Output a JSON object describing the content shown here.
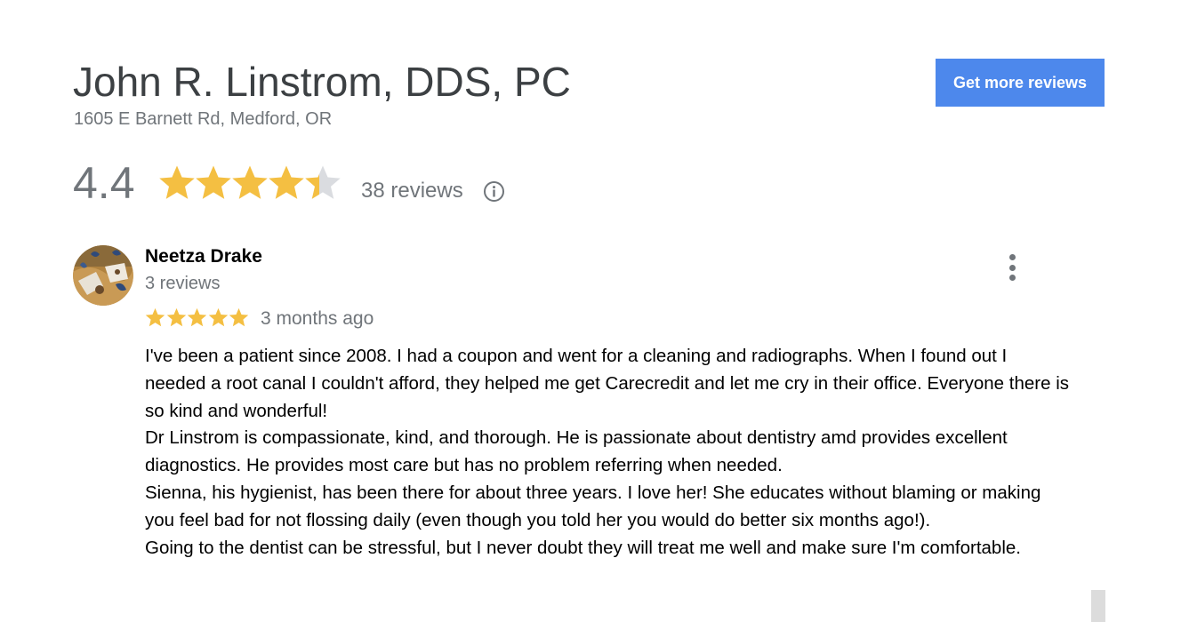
{
  "business": {
    "name": "John R. Linstrom, DDS, PC",
    "address": "1605 E Barnett Rd, Medford, OR",
    "cta_label": "Get more reviews",
    "accent_color": "#4d88ec"
  },
  "rating": {
    "value": "4.4",
    "stars_filled": 4.4,
    "stars_total": 5,
    "review_count": "38 reviews",
    "info_icon": "info-icon",
    "star_color": "#f4bf42"
  },
  "review": {
    "author": "Neetza Drake",
    "author_reviews": "3 reviews",
    "rating": 5,
    "time": "3 months ago",
    "menu_icon": "more-vertical-icon",
    "paragraphs": [
      "I've been a patient since 2008. I had a coupon and went for a cleaning and radiographs. When I found out I needed a root canal I couldn't afford, they helped me get Carecredit and let me cry in their office. Everyone there is so kind and wonderful!",
      "Dr Linstrom is compassionate, kind, and thorough. He is passionate about dentistry amd provides excellent diagnostics. He provides most care but has no problem referring when needed.",
      "Sienna, his hygienist, has been there for about three years. I love her! She educates without blaming or making you feel bad for not flossing daily (even though you told her you would do better six months ago!).",
      "Going to the dentist can be stressful, but I never doubt they will treat me well and make sure I'm comfortable."
    ]
  }
}
